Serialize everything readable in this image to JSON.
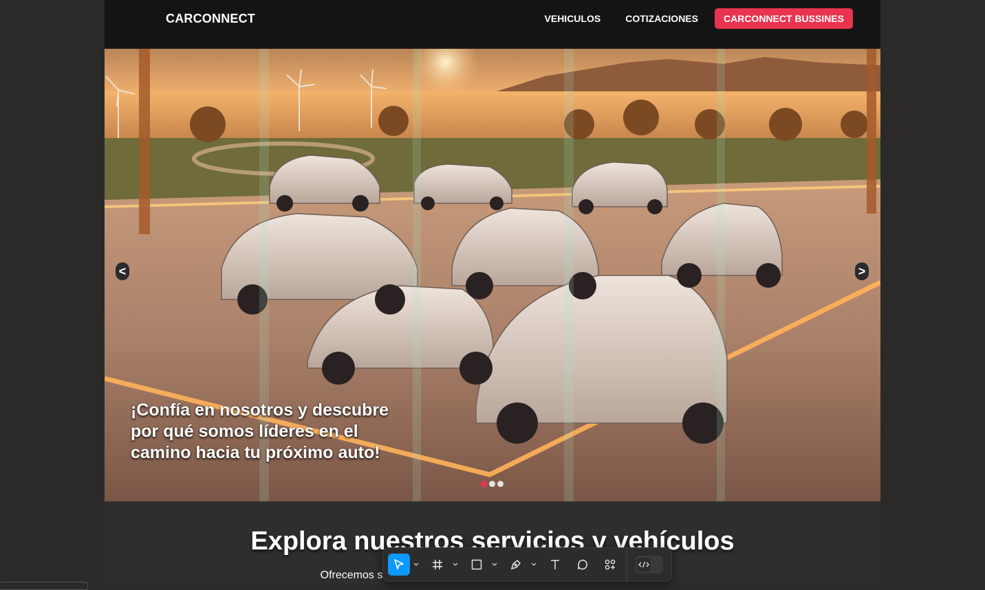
{
  "header": {
    "brand": "CARCONNECT",
    "nav": [
      {
        "label": "VEHICULOS"
      },
      {
        "label": "COTIZACIONES"
      }
    ],
    "cta_label": "CARCONNECT BUSSINES"
  },
  "hero": {
    "caption": "¡Confía en nosotros y descubre por qué somos líderes en el camino hacia tu próximo auto!",
    "prev_label": "<",
    "next_label": ">",
    "slides_count": 3,
    "active_slide": 1
  },
  "section": {
    "title": "Explora nuestros servicios y vehículos",
    "subtitle": "Ofrecemos soluciones integrales para comprar, vender y cotizar autos."
  },
  "toolbar": {
    "tools": [
      {
        "icon": "move-pointer-icon",
        "active": true
      },
      {
        "icon": "frame-icon",
        "active": false
      },
      {
        "icon": "rectangle-icon",
        "active": false
      },
      {
        "icon": "pen-icon",
        "active": false
      },
      {
        "icon": "text-icon",
        "active": false
      },
      {
        "icon": "comment-icon",
        "active": false
      },
      {
        "icon": "actions-icon",
        "active": false
      }
    ],
    "dev_mode_icon": "code-icon"
  },
  "colors": {
    "accent": "#e8344f",
    "header_bg": "#141414",
    "toolbar_active": "#0d99ff"
  }
}
